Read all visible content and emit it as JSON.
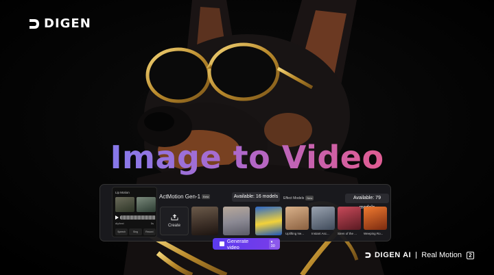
{
  "brand": {
    "logo_text": "DIGEN",
    "logo_icon": "digen-mark-icon"
  },
  "hero": {
    "title": "Image to Video"
  },
  "lip_motion": {
    "title": "Lip Motion",
    "wave_label": "diy/text",
    "wave_time": "5s",
    "options": [
      "Speech",
      "Sing",
      "Record"
    ]
  },
  "generator": {
    "model_label": "ActMotion Gen-1",
    "model_badge": "Beta",
    "available_label": "Available: 16 models",
    "create_label": "Create",
    "create_icon": "upload-icon"
  },
  "effects": {
    "label": "Effect Models",
    "badge": "New",
    "available_label": "Available: 79 models",
    "items": [
      {
        "caption": "Uplifting Ne..."
      },
      {
        "caption": "Instant Asc..."
      },
      {
        "caption": "Siren of the ..."
      },
      {
        "caption": "Weeping Ro..."
      }
    ]
  },
  "generate": {
    "label": "Generate video",
    "cost": "♦ 30",
    "icon": "sparkle-icon"
  },
  "footer": {
    "brand": "DIGEN AI",
    "product": "Real Motion",
    "version": "2"
  },
  "colors": {
    "accent": "#6a3cec",
    "title_start": "#6c7ef5",
    "title_end": "#ee5c78"
  }
}
